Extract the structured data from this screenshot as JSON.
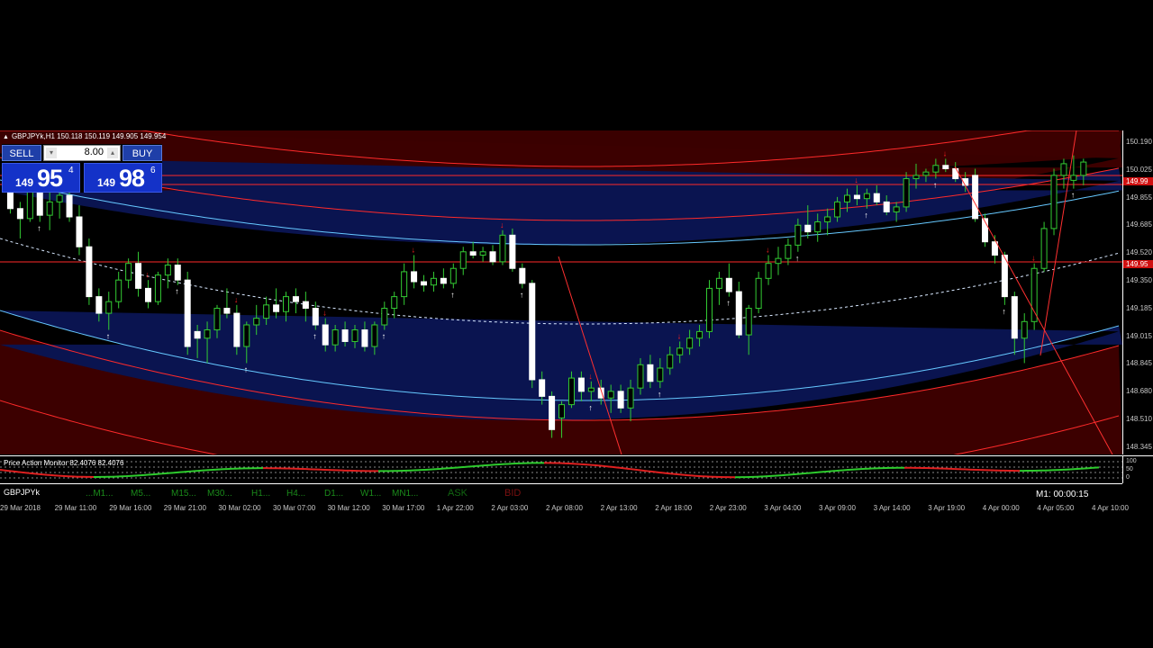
{
  "chart": {
    "title": "GBPJPYk,H1  150.118 150.119 149.905 149.954",
    "colors": {
      "background": "#000000",
      "bull": "#ffffff",
      "bear": "#ffffff",
      "wick": "#33cc33",
      "band_red": "#4a0000",
      "band_blue": "#08104a",
      "up_arrow": "#ffffff",
      "down_arrow": "#ff2020"
    }
  },
  "trade_panel": {
    "sell_label": "SELL",
    "buy_label": "BUY",
    "lot": "8.00",
    "bid": {
      "prefix": "149",
      "big": "95",
      "sup": "4"
    },
    "ask": {
      "prefix": "149",
      "big": "98",
      "sup": "6"
    }
  },
  "price_axis": {
    "ticks": [
      "150.190",
      "150.025",
      "149.855",
      "149.685",
      "149.520",
      "149.350",
      "149.185",
      "149.015",
      "148.845",
      "148.680",
      "148.510",
      "148.345"
    ],
    "tags": [
      "149.99",
      "149.95"
    ]
  },
  "indicator": {
    "title": "Price Action Monitor 82.4076 82.4076",
    "ticks": [
      "100",
      "50",
      "0"
    ]
  },
  "timeframes": {
    "symbol": "GBPJPYk",
    "items": [
      "M1",
      "M5",
      "M15",
      "M30",
      "H1",
      "H4",
      "D1",
      "W1",
      "MN1"
    ],
    "ask": "ASK",
    "bid": "BID",
    "timer": "M1:  00:00:15"
  },
  "time_axis": [
    "29 Mar 2018",
    "29 Mar 11:00",
    "29 Mar 16:00",
    "29 Mar 21:00",
    "30 Mar 02:00",
    "30 Mar 07:00",
    "30 Mar 12:00",
    "30 Mar 17:00",
    "1 Apr 22:00",
    "2 Apr 03:00",
    "2 Apr 08:00",
    "2 Apr 13:00",
    "2 Apr 18:00",
    "2 Apr 23:00",
    "3 Apr 04:00",
    "3 Apr 09:00",
    "3 Apr 14:00",
    "3 Apr 19:00",
    "4 Apr 00:00",
    "4 Apr 05:00",
    "4 Apr 10:00"
  ],
  "chart_data": {
    "type": "candlestick",
    "ylim": [
      148.3,
      150.25
    ],
    "candles": [
      [
        149.9,
        150.0,
        149.75,
        149.78
      ],
      [
        149.78,
        149.82,
        149.6,
        149.72
      ],
      [
        149.72,
        149.95,
        149.7,
        149.88
      ],
      [
        149.88,
        149.92,
        149.7,
        149.74
      ],
      [
        149.74,
        149.9,
        149.65,
        149.82
      ],
      [
        149.82,
        149.95,
        149.72,
        149.86
      ],
      [
        149.86,
        149.92,
        149.7,
        149.73
      ],
      [
        149.73,
        149.8,
        149.5,
        149.55
      ],
      [
        149.55,
        149.6,
        149.2,
        149.25
      ],
      [
        149.25,
        149.3,
        149.1,
        149.15
      ],
      [
        149.15,
        149.28,
        149.05,
        149.22
      ],
      [
        149.22,
        149.4,
        149.18,
        149.35
      ],
      [
        149.35,
        149.48,
        149.3,
        149.45
      ],
      [
        149.45,
        149.52,
        149.25,
        149.3
      ],
      [
        149.3,
        149.35,
        149.18,
        149.22
      ],
      [
        149.22,
        149.4,
        149.2,
        149.38
      ],
      [
        149.38,
        149.48,
        149.3,
        149.44
      ],
      [
        149.44,
        149.48,
        149.32,
        149.35
      ],
      [
        149.35,
        149.4,
        148.9,
        148.95
      ],
      [
        149.04,
        149.08,
        148.88,
        149.0
      ],
      [
        149.0,
        149.1,
        148.85,
        149.05
      ],
      [
        149.05,
        149.2,
        149.0,
        149.18
      ],
      [
        149.18,
        149.3,
        149.12,
        149.15
      ],
      [
        149.15,
        149.2,
        148.9,
        148.95
      ],
      [
        148.95,
        149.1,
        148.85,
        149.08
      ],
      [
        149.08,
        149.2,
        149.02,
        149.12
      ],
      [
        149.12,
        149.25,
        149.08,
        149.2
      ],
      [
        149.2,
        149.3,
        149.12,
        149.16
      ],
      [
        149.16,
        149.28,
        149.1,
        149.25
      ],
      [
        149.25,
        149.3,
        149.15,
        149.22
      ],
      [
        149.22,
        149.28,
        149.1,
        149.18
      ],
      [
        149.18,
        149.22,
        149.05,
        149.08
      ],
      [
        149.08,
        149.12,
        148.92,
        148.96
      ],
      [
        148.96,
        149.08,
        148.92,
        149.05
      ],
      [
        149.05,
        149.1,
        148.95,
        148.98
      ],
      [
        148.98,
        149.08,
        148.94,
        149.05
      ],
      [
        149.05,
        149.1,
        148.92,
        148.95
      ],
      [
        148.95,
        149.1,
        148.9,
        149.08
      ],
      [
        149.08,
        149.22,
        149.05,
        149.18
      ],
      [
        149.18,
        149.28,
        149.12,
        149.25
      ],
      [
        149.25,
        149.45,
        149.2,
        149.4
      ],
      [
        149.4,
        149.5,
        149.3,
        149.34
      ],
      [
        149.34,
        149.38,
        149.28,
        149.32
      ],
      [
        149.32,
        149.4,
        149.28,
        149.36
      ],
      [
        149.36,
        149.42,
        149.3,
        149.33
      ],
      [
        149.33,
        149.45,
        149.3,
        149.42
      ],
      [
        149.42,
        149.55,
        149.38,
        149.52
      ],
      [
        149.52,
        149.58,
        149.48,
        149.5
      ],
      [
        149.5,
        149.55,
        149.46,
        149.52
      ],
      [
        149.52,
        149.56,
        149.44,
        149.46
      ],
      [
        149.46,
        149.65,
        149.44,
        149.62
      ],
      [
        149.62,
        149.66,
        149.4,
        149.42
      ],
      [
        149.42,
        149.45,
        149.3,
        149.33
      ],
      [
        149.33,
        149.35,
        148.7,
        148.75
      ],
      [
        148.75,
        148.8,
        148.6,
        148.65
      ],
      [
        148.65,
        148.68,
        148.4,
        148.45
      ],
      [
        148.52,
        148.62,
        148.4,
        148.6
      ],
      [
        148.6,
        148.8,
        148.58,
        148.76
      ],
      [
        148.76,
        148.8,
        148.62,
        148.68
      ],
      [
        148.68,
        148.74,
        148.62,
        148.7
      ],
      [
        148.7,
        148.75,
        148.6,
        148.64
      ],
      [
        148.64,
        148.72,
        148.55,
        148.68
      ],
      [
        148.68,
        148.72,
        148.55,
        148.58
      ],
      [
        148.58,
        148.75,
        148.5,
        148.7
      ],
      [
        148.7,
        148.88,
        148.66,
        148.84
      ],
      [
        148.84,
        148.9,
        148.7,
        148.74
      ],
      [
        148.74,
        148.88,
        148.7,
        148.82
      ],
      [
        148.82,
        148.95,
        148.78,
        148.9
      ],
      [
        148.9,
        148.98,
        148.85,
        148.94
      ],
      [
        148.94,
        149.05,
        148.9,
        149.0
      ],
      [
        149.0,
        149.08,
        148.95,
        149.04
      ],
      [
        149.04,
        149.35,
        149.0,
        149.3
      ],
      [
        149.3,
        149.4,
        149.2,
        149.36
      ],
      [
        149.36,
        149.45,
        149.25,
        149.28
      ],
      [
        149.28,
        149.34,
        149.0,
        149.02
      ],
      [
        149.02,
        149.2,
        148.9,
        149.18
      ],
      [
        149.18,
        149.4,
        149.15,
        149.36
      ],
      [
        149.36,
        149.5,
        149.32,
        149.45
      ],
      [
        149.45,
        149.55,
        149.38,
        149.48
      ],
      [
        149.48,
        149.6,
        149.44,
        149.56
      ],
      [
        149.56,
        149.72,
        149.52,
        149.68
      ],
      [
        149.68,
        149.8,
        149.6,
        149.64
      ],
      [
        149.64,
        149.75,
        149.58,
        149.7
      ],
      [
        149.7,
        149.78,
        149.62,
        149.73
      ],
      [
        149.73,
        149.85,
        149.7,
        149.82
      ],
      [
        149.82,
        149.9,
        149.76,
        149.86
      ],
      [
        149.86,
        149.92,
        149.8,
        149.84
      ],
      [
        149.84,
        149.9,
        149.78,
        149.87
      ],
      [
        149.87,
        149.92,
        149.8,
        149.82
      ],
      [
        149.82,
        149.86,
        149.74,
        149.76
      ],
      [
        149.76,
        149.82,
        149.7,
        149.79
      ],
      [
        149.79,
        150.0,
        149.76,
        149.96
      ],
      [
        149.96,
        150.05,
        149.9,
        149.98
      ],
      [
        149.98,
        150.02,
        149.94,
        150.0
      ],
      [
        150.0,
        150.08,
        149.96,
        150.04
      ],
      [
        150.04,
        150.08,
        150.0,
        150.02
      ],
      [
        150.02,
        150.06,
        149.94,
        149.96
      ],
      [
        149.96,
        150.0,
        149.88,
        149.92
      ],
      [
        149.98,
        150.02,
        149.7,
        149.72
      ],
      [
        149.72,
        149.75,
        149.55,
        149.58
      ],
      [
        149.58,
        149.62,
        149.45,
        149.5
      ],
      [
        149.5,
        149.52,
        149.2,
        149.25
      ],
      [
        149.25,
        149.28,
        148.9,
        149.0
      ],
      [
        149.0,
        149.15,
        148.85,
        149.1
      ],
      [
        149.1,
        149.45,
        149.05,
        149.42
      ],
      [
        149.42,
        149.7,
        149.4,
        149.66
      ],
      [
        149.66,
        150.02,
        149.62,
        149.98
      ],
      [
        149.98,
        150.08,
        149.9,
        150.05
      ],
      [
        149.95,
        150.1,
        149.9,
        149.98
      ],
      [
        149.98,
        150.08,
        149.92,
        150.06
      ]
    ]
  }
}
